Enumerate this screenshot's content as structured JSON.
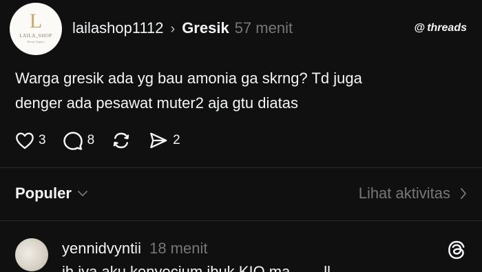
{
  "post": {
    "author": "lailashop1112",
    "location": "Gresik",
    "time": "57 menit",
    "avatar_logo": {
      "letter": "L",
      "name": "LAILA_SHOP",
      "tagline": "Beauty Support"
    },
    "text_lines": [
      "Warga gresik ada yg bau amonia ga skrng? Td juga",
      "denger ada pesawat muter2 aja gtu diatas"
    ],
    "actions": {
      "likes": "3",
      "replies": "8",
      "shares": "2"
    }
  },
  "brand": {
    "at_symbol": "@",
    "name": "threads"
  },
  "sort_bar": {
    "sort_label": "Populer",
    "activity_label": "Lihat aktivitas"
  },
  "reply": {
    "author": "yennidvyntii",
    "time": "18 menit",
    "preview_text": "ih iya aku kenyecium ibuk KIO ma.... ...ll"
  },
  "colors": {
    "background": "#101010",
    "text_primary": "#f3f5f7",
    "text_secondary": "#777777",
    "divider": "#2a2a2a"
  },
  "icons": {
    "like": "heart-icon",
    "reply": "comment-bubble-icon",
    "repost": "repost-icon",
    "share": "send-icon",
    "chevron_down": "chevron-down-icon",
    "chevron_right": "chevron-right-icon",
    "threads_logo": "threads-logo-icon"
  }
}
